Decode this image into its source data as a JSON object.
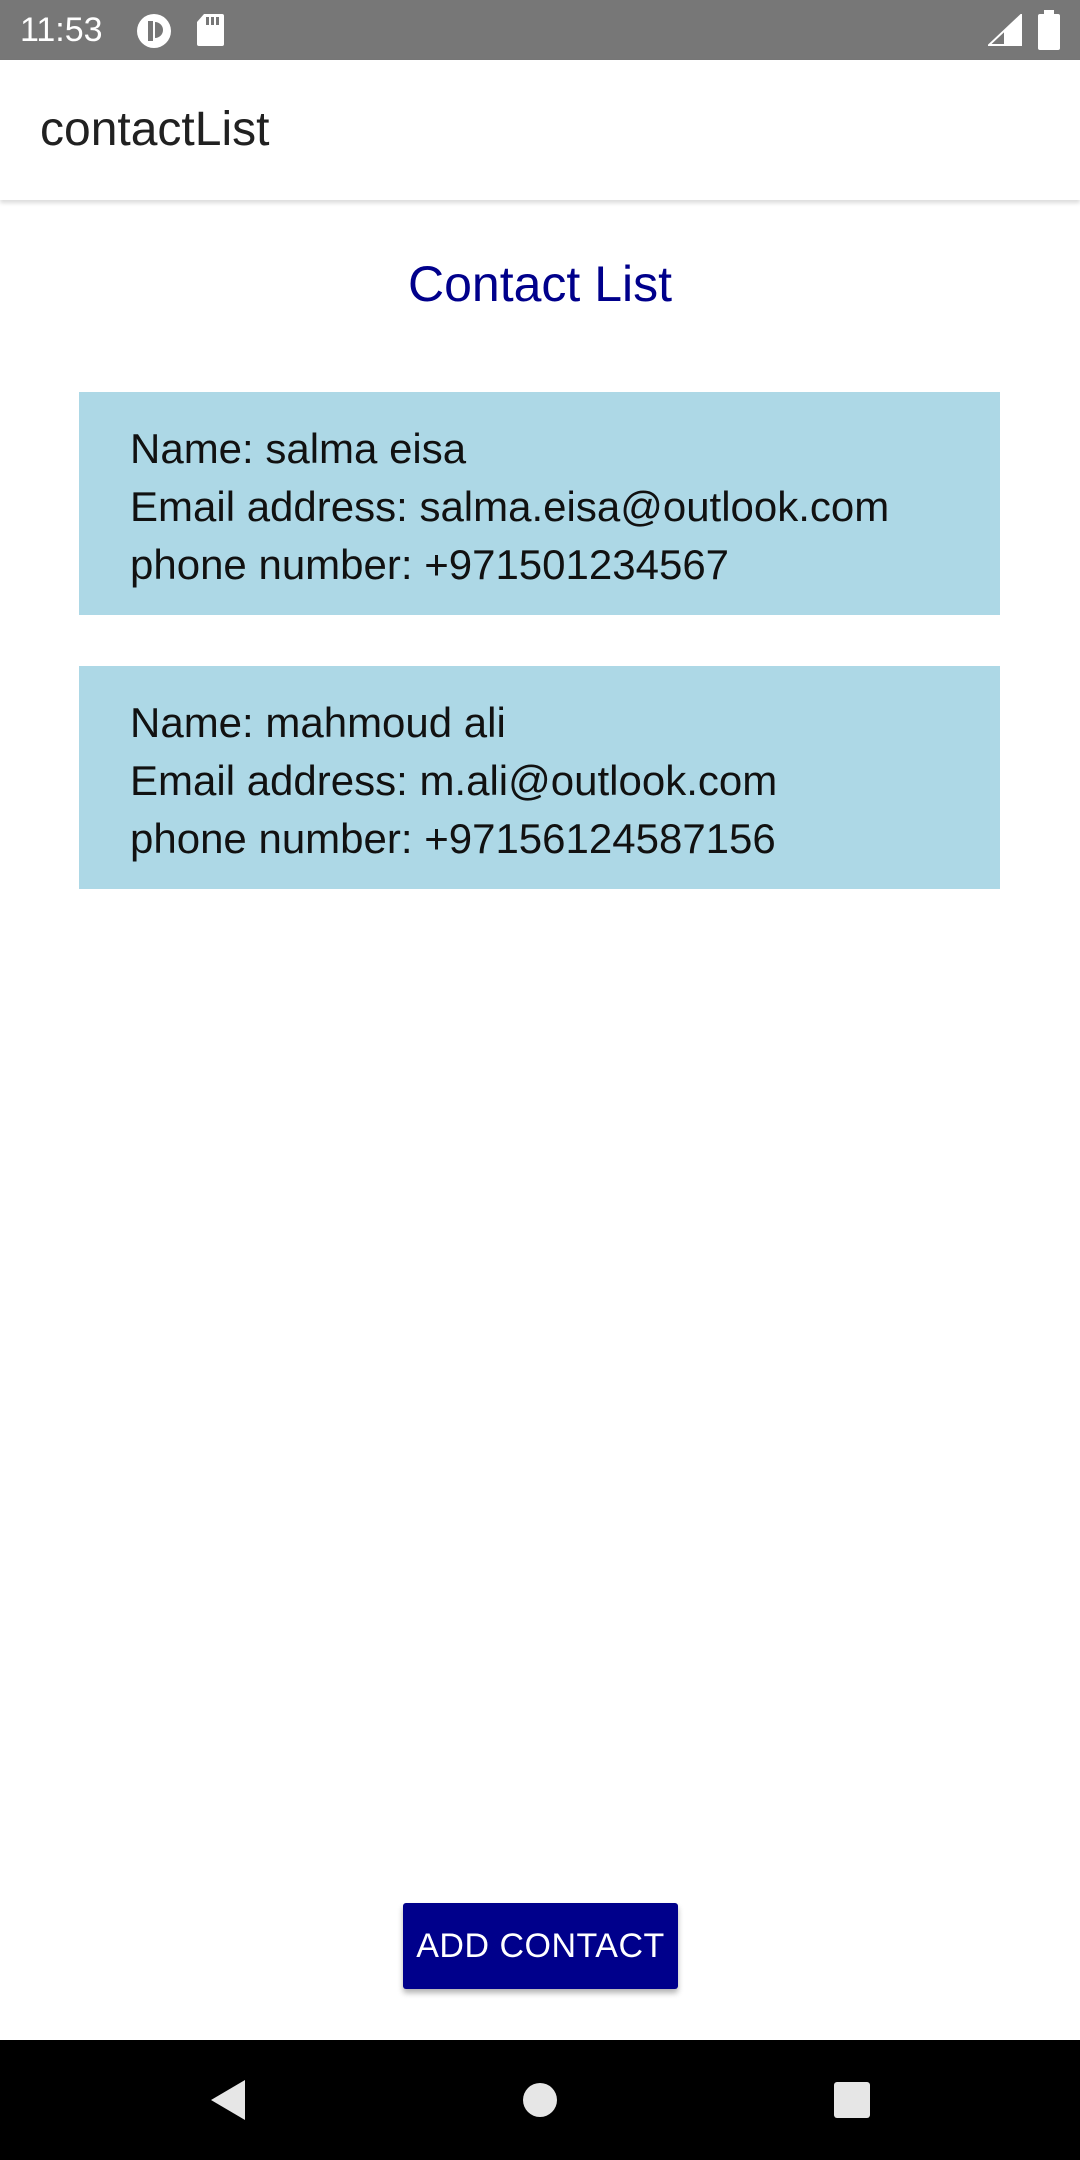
{
  "status_bar": {
    "time": "11:53",
    "icons": [
      "app-notification-icon",
      "sd-card-icon",
      "signal-icon",
      "battery-icon"
    ]
  },
  "app_bar": {
    "title": "contactList"
  },
  "main": {
    "heading": "Contact List",
    "contacts": [
      {
        "name_line": "Name: salma eisa",
        "email_line": "Email address: salma.eisa@outlook.com",
        "phone_line": "phone number: +971501234567"
      },
      {
        "name_line": "Name: mahmoud ali",
        "email_line": "Email address: m.ali@outlook.com",
        "phone_line": "phone number: +97156124587156"
      }
    ],
    "add_button_label": "ADD CONTACT"
  },
  "nav_bar": {
    "icons": [
      "back-icon",
      "home-icon",
      "recents-icon"
    ]
  },
  "colors": {
    "status_bar": "#777777",
    "heading": "#00008b",
    "card_background": "#add8e6",
    "button_background": "#00008b",
    "nav_bar": "#000000"
  }
}
